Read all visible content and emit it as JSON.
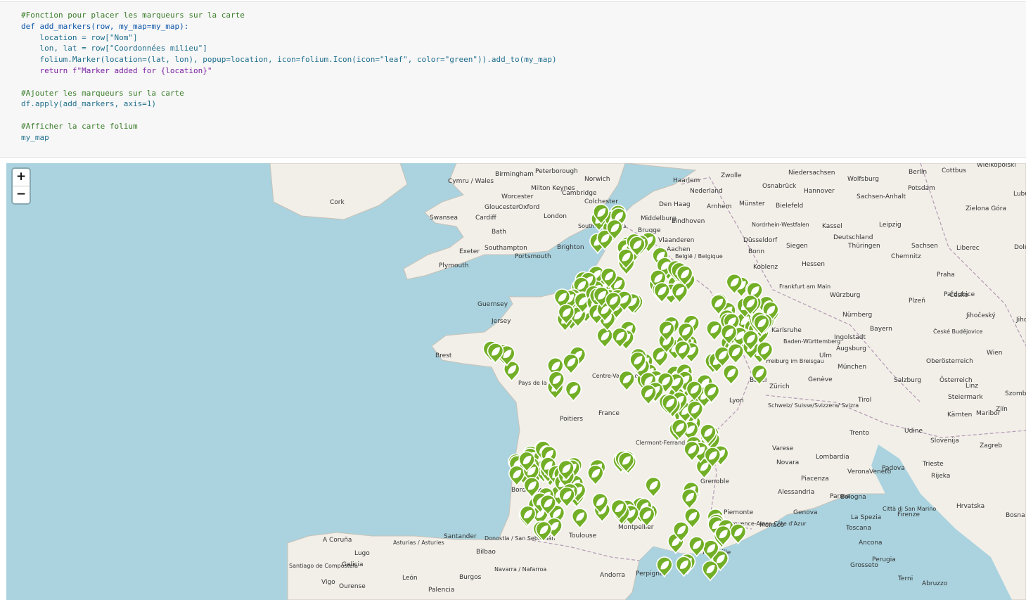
{
  "notebook": {
    "code_lines": [
      "#Fonction pour placer les marqueurs sur la carte",
      "def add_markers(row, my_map=my_map):",
      "    location = row[\"Nom\"]",
      "    lon, lat = row[\"Coordonnées milieu\"]",
      "    folium.Marker(location=(lat, lon), popup=location, icon=folium.Icon(icon=\"leaf\", color=\"green\")).add_to(my_map)",
      "    return f\"Marker added for {location}\"",
      "",
      "#Ajouter les marqueurs sur la carte",
      "df.apply(add_markers, axis=1)",
      "",
      "#Afficher la carte folium",
      "my_map"
    ]
  },
  "map": {
    "zoom_in_label": "+",
    "zoom_out_label": "−",
    "marker_icon": "leaf-icon",
    "marker_color": "#72af26",
    "water_color": "#aad3df",
    "land_color": "#f2efe9",
    "place_labels": [
      "Birmingham",
      "Peterborough",
      "Norwich",
      "Cymru / Wales",
      "Milton Keynes",
      "Cambridge",
      "Worcester",
      "Colchester",
      "Gloucester",
      "Oxford",
      "London",
      "Swansea",
      "Cardiff",
      "Bath",
      "Southend on Sea",
      "Exeter",
      "Southampton",
      "Brighton",
      "Portsmouth",
      "Plymouth",
      "Cork",
      "Guernsey",
      "Jersey",
      "Brest",
      "Pays de la Loire",
      "Poitiers",
      "Centre-Val de Loire",
      "France",
      "Clermont-Ferrand",
      "Grenoble",
      "Bordeaux",
      "Toulouse",
      "Montpellier",
      "Marseille",
      "Perpignan",
      "Andorra",
      "A Coruña",
      "Lugo",
      "Santiago de Compostela",
      "Galicia",
      "Vigo",
      "Ourense",
      "Asturias / Asturies",
      "Santander",
      "Bilbao",
      "Donostia / San Sebastián",
      "León",
      "Burgos",
      "Navarra / Nafarroa",
      "Palencia",
      "Haarlem",
      "Nederland",
      "Den Haag",
      "Arnhem",
      "Middelburg",
      "Eindhoven",
      "Brugge",
      "Vlaanderen",
      "België / Belgique",
      "Aachen",
      "Bonn",
      "Düsseldorf",
      "Koblenz",
      "Zwolle",
      "Osnabrück",
      "Münster",
      "Bielefeld",
      "Nordrhein-Westfalen",
      "Hannover",
      "Wolfsburg",
      "Berlin",
      "Potsdam",
      "Niedersachsen",
      "Sachsen-Anhalt",
      "Kassel",
      "Leipzig",
      "Deutschland",
      "Siegen",
      "Hessen",
      "Frankfurt am Main",
      "Würzburg",
      "Thüringen",
      "Sachsen",
      "Chemnitz",
      "Nürnberg",
      "Bayern",
      "Karlsruhe",
      "Baden-Württemberg",
      "Ingolstadt",
      "Augsburg",
      "Ulm",
      "München",
      "Freiburg im Breisgau",
      "Basel",
      "Zürich",
      "Schweiz/ Suisse/Svizzera/ Svizra",
      "Lyon",
      "Genève",
      "Cottbus",
      "Zielona Góra",
      "Liberec",
      "Praha",
      "Plzeň",
      "Česko",
      "České Budějovice",
      "Pardubice",
      "Wien",
      "Österreich",
      "Salzburg",
      "Linz",
      "Trento",
      "Udine",
      "Slovenija",
      "Zagreb",
      "Varese",
      "Novara",
      "Lombardia",
      "Verona",
      "Padova",
      "Trieste",
      "Rijeka",
      "Piacenza",
      "Alessandria",
      "Parma",
      "Bologna",
      "Genova",
      "La Spezia",
      "Città di San Marino",
      "Firenze",
      "Toscana",
      "Ancona",
      "Perugia",
      "Grosseto",
      "Hrvatska",
      "Bosna i",
      "Terni",
      "Piemonte",
      "Veneto",
      "Provence-Alpes-Côte d'Azur",
      "Monaco",
      "Wielkopolski",
      "Lubuskie",
      "Dolnośląskie",
      "Jihočeský",
      "Steiermark",
      "Kärnten",
      "Maribor",
      "Szombathely",
      "Oberösterreich",
      "Tirol",
      "Jihomoravský",
      "Zlín",
      "Abruzzo"
    ]
  }
}
